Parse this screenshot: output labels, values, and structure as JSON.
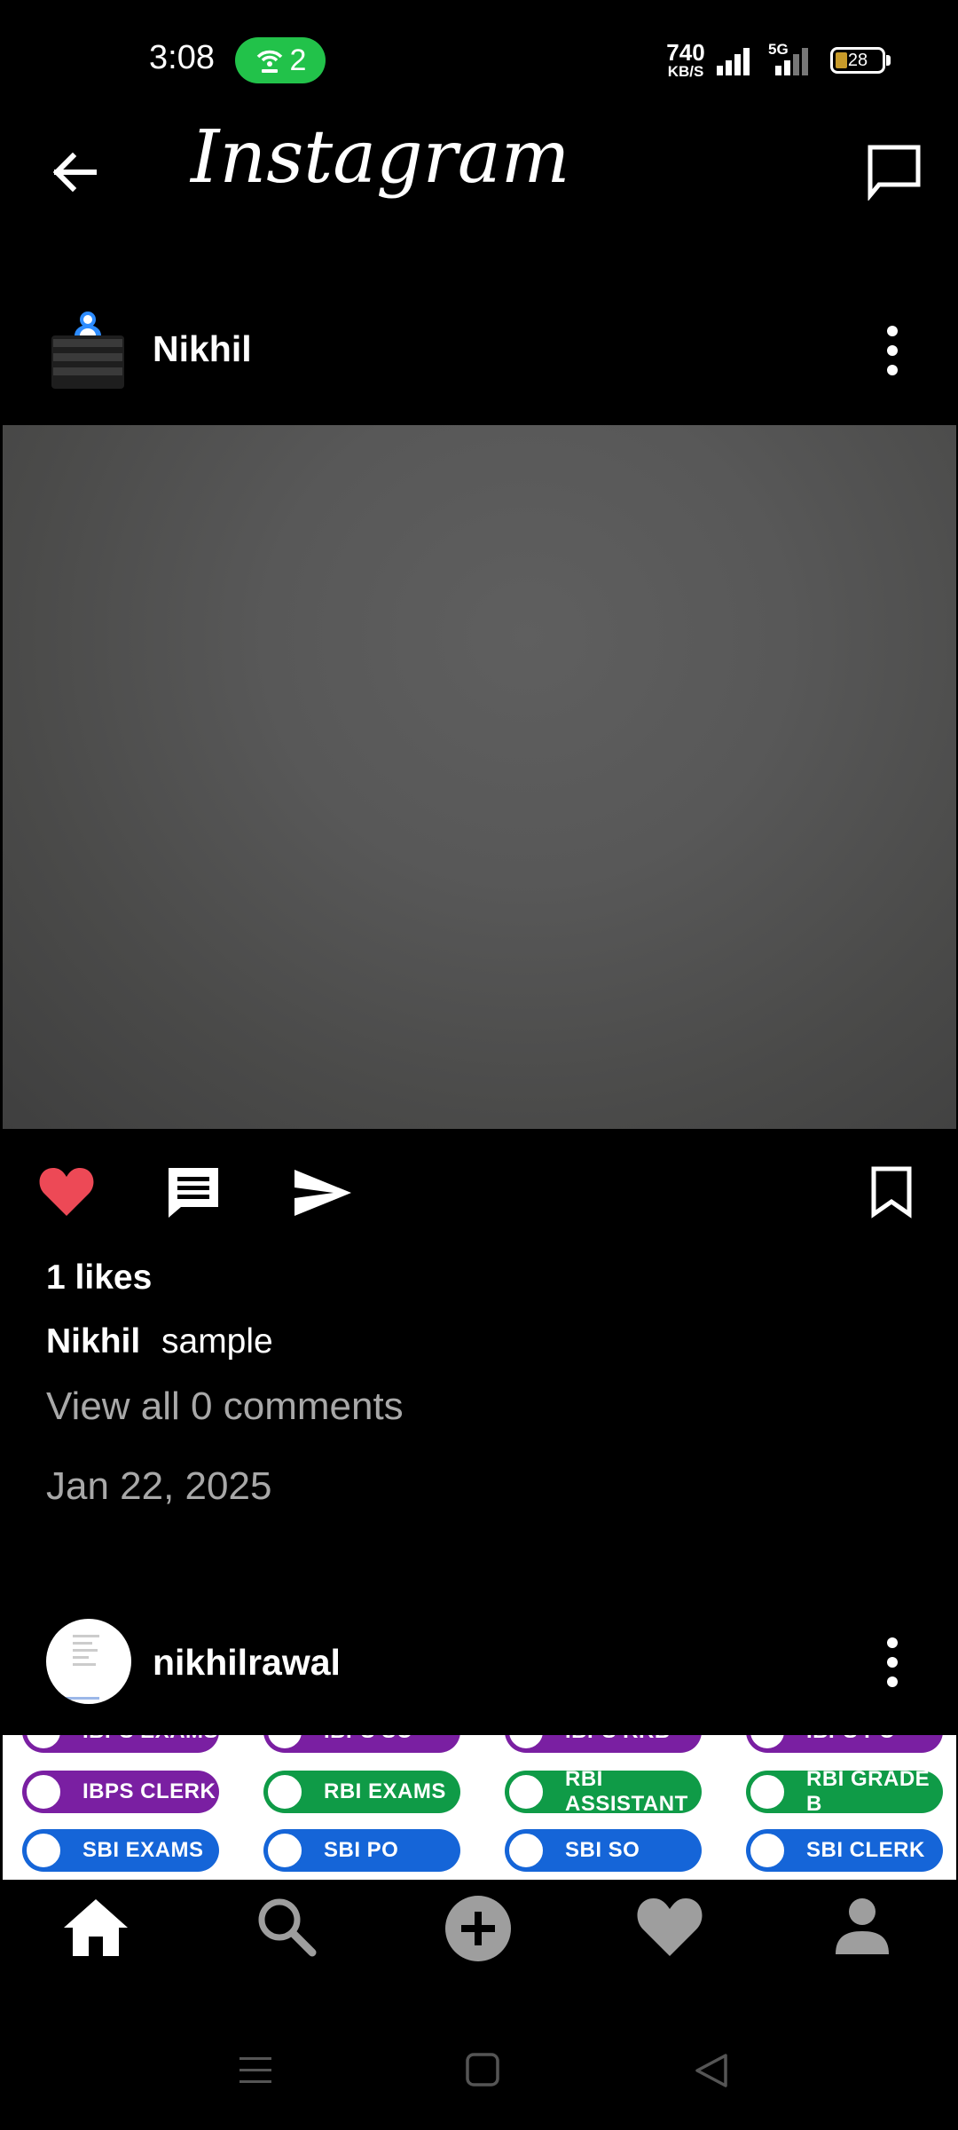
{
  "status_bar": {
    "time": "3:08",
    "hotspot_count": "2",
    "net_speed_value": "740",
    "net_speed_unit": "KB/S",
    "network_type": "5G",
    "battery_level": "28",
    "hotspot_color": "#22c24a"
  },
  "header": {
    "app_title": "Instagram",
    "back_icon": "back-arrow-icon",
    "messages_icon": "message-square-icon"
  },
  "post1": {
    "username": "Nikhil",
    "likes": "1 likes",
    "caption_user": "Nikhil",
    "caption_text": "sample",
    "comments_link": "View all 0 comments",
    "date": "Jan 22, 2025",
    "liked": true,
    "like_color": "#ed4956"
  },
  "post2": {
    "username": "nikhilrawal",
    "banner_pills": [
      {
        "label": "IBPS EXAMS",
        "color": "purple"
      },
      {
        "label": "IBPS SO",
        "color": "purple"
      },
      {
        "label": "IBPS RRB",
        "color": "purple"
      },
      {
        "label": "IBPS PO",
        "color": "purple"
      },
      {
        "label": "IBPS CLERK",
        "color": "purple"
      },
      {
        "label": "RBI EXAMS",
        "color": "green"
      },
      {
        "label": "RBI ASSISTANT",
        "color": "green"
      },
      {
        "label": "RBI GRADE B",
        "color": "green"
      },
      {
        "label": "SBI EXAMS",
        "color": "blue"
      },
      {
        "label": "SBI PO",
        "color": "blue"
      },
      {
        "label": "SBI SO",
        "color": "blue"
      },
      {
        "label": "SBI CLERK",
        "color": "blue"
      }
    ]
  },
  "bottom_nav": {
    "items": [
      "home-icon",
      "search-icon",
      "add-post-icon",
      "activity-heart-icon",
      "profile-icon"
    ]
  },
  "system_nav": {
    "items": [
      "recents-menu-icon",
      "home-square-icon",
      "back-triangle-icon"
    ]
  }
}
